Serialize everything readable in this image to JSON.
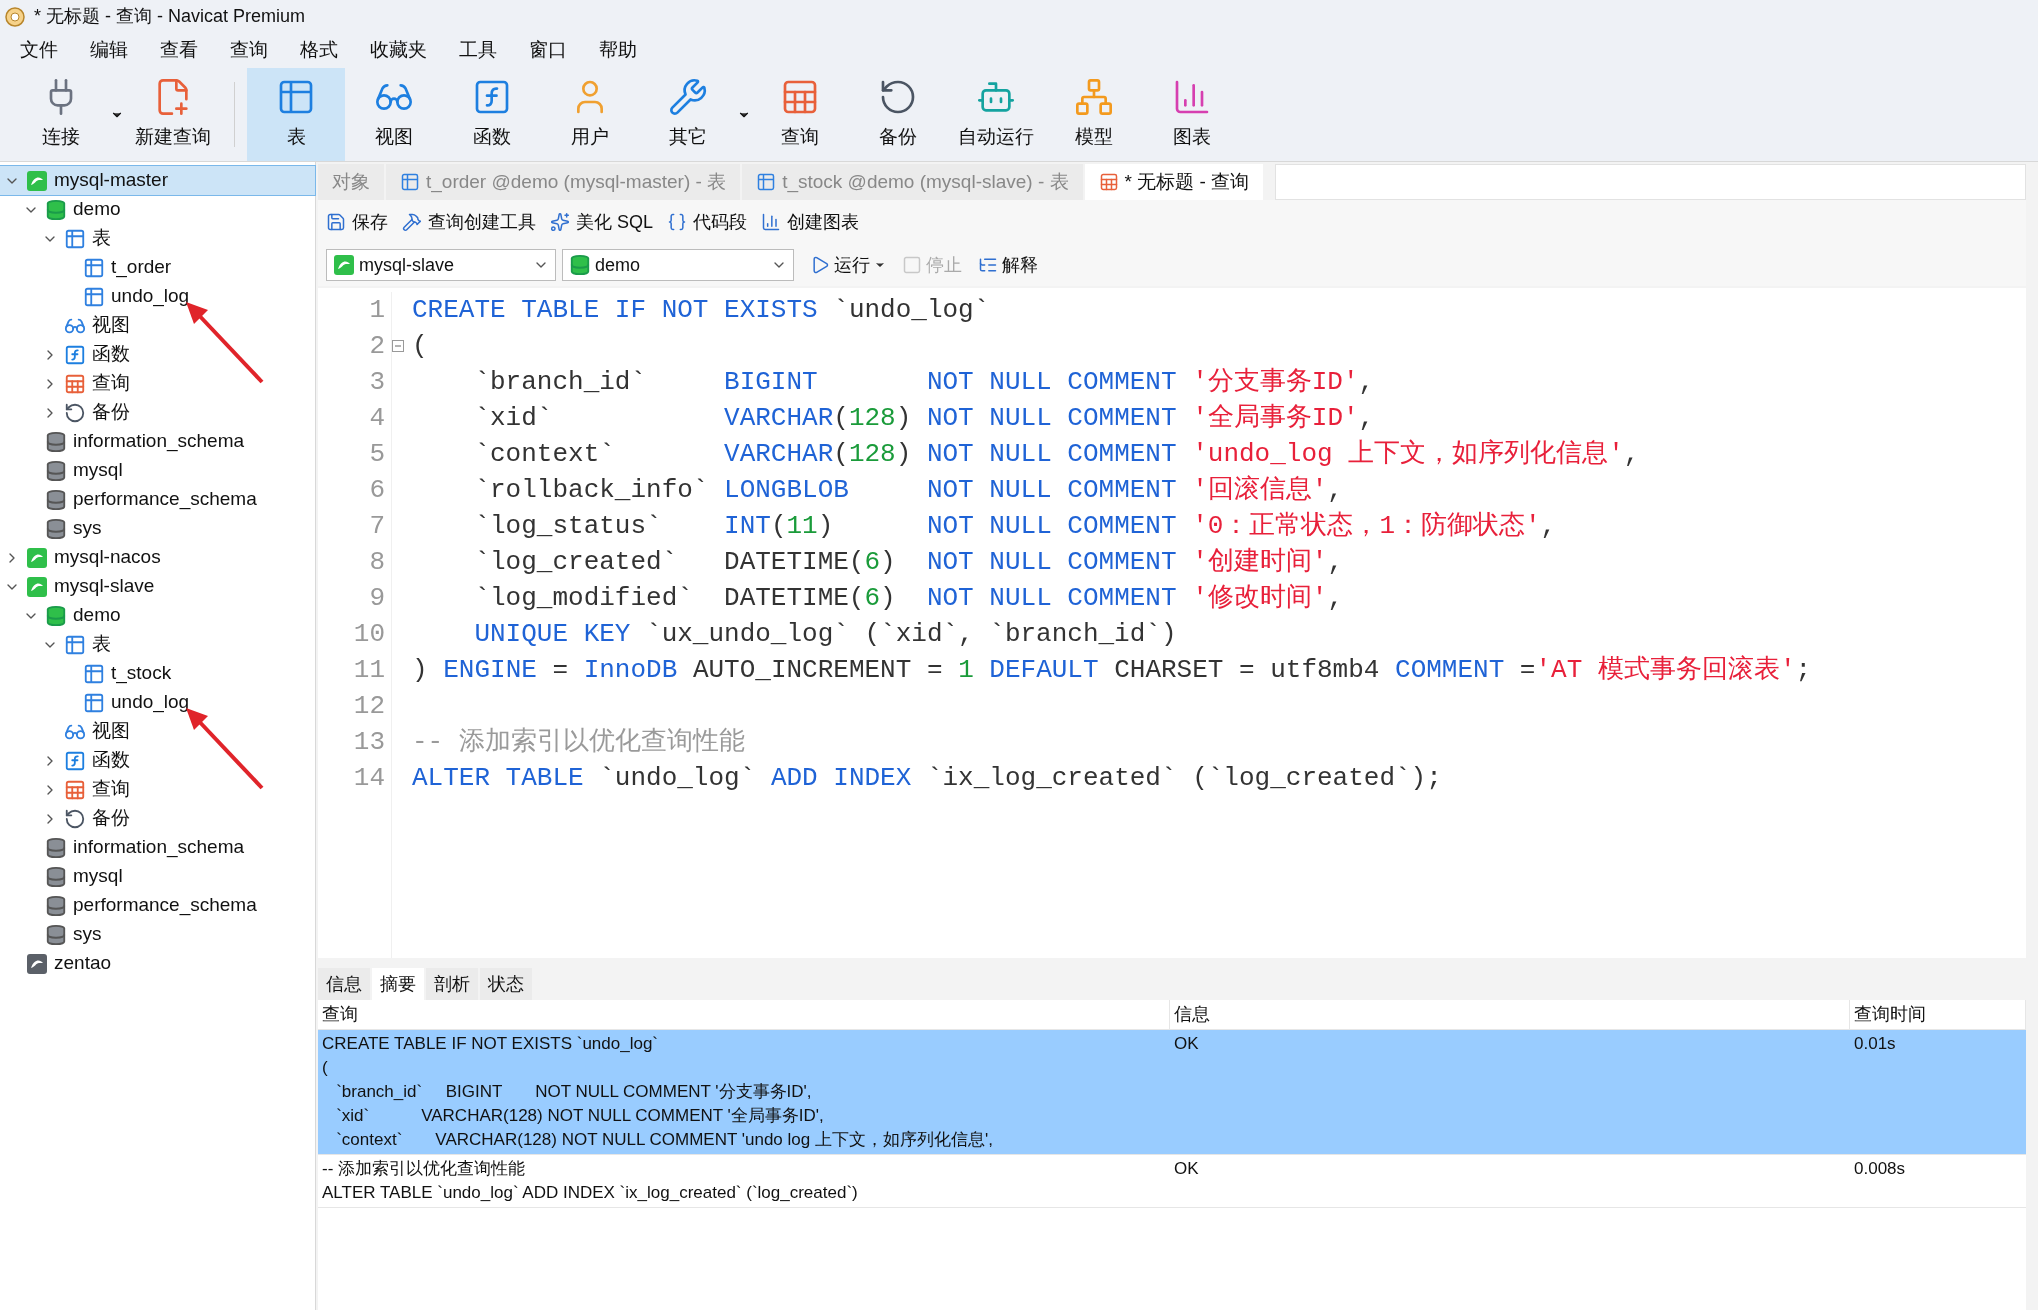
{
  "window": {
    "title": "* 无标题 - 查询 - Navicat Premium"
  },
  "menu": [
    "文件",
    "编辑",
    "查看",
    "查询",
    "格式",
    "收藏夹",
    "工具",
    "窗口",
    "帮助"
  ],
  "toolbar": [
    {
      "label": "连接",
      "kind": "plug",
      "selected": false,
      "dropdown": true
    },
    {
      "label": "新建查询",
      "kind": "new-query",
      "selected": false,
      "dropdown": false
    },
    {
      "label": "表",
      "kind": "table",
      "selected": true,
      "dropdown": false
    },
    {
      "label": "视图",
      "kind": "view",
      "selected": false,
      "dropdown": false
    },
    {
      "label": "函数",
      "kind": "function",
      "selected": false,
      "dropdown": false
    },
    {
      "label": "用户",
      "kind": "user",
      "selected": false,
      "dropdown": false
    },
    {
      "label": "其它",
      "kind": "tools",
      "selected": false,
      "dropdown": true
    },
    {
      "label": "查询",
      "kind": "query",
      "selected": false,
      "dropdown": false
    },
    {
      "label": "备份",
      "kind": "backup",
      "selected": false,
      "dropdown": false
    },
    {
      "label": "自动运行",
      "kind": "robot",
      "selected": false,
      "dropdown": false
    },
    {
      "label": "模型",
      "kind": "model",
      "selected": false,
      "dropdown": false
    },
    {
      "label": "图表",
      "kind": "chart",
      "selected": false,
      "dropdown": false
    }
  ],
  "tree": [
    {
      "label": "mysql-master",
      "kind": "connection",
      "expanded": true,
      "selected": true,
      "marked": false,
      "children": [
        {
          "label": "demo",
          "kind": "database",
          "expanded": true,
          "selected": false,
          "marked": false,
          "children": [
            {
              "label": "表",
              "kind": "tables",
              "expanded": true,
              "selected": false,
              "marked": false,
              "children": [
                {
                  "label": "t_order",
                  "kind": "table",
                  "selected": false,
                  "marked": false
                },
                {
                  "label": "undo_log",
                  "kind": "table",
                  "selected": false,
                  "marked": true
                }
              ]
            },
            {
              "label": "视图",
              "kind": "views",
              "selected": false,
              "marked": false
            },
            {
              "label": "函数",
              "kind": "functions",
              "expanded": false,
              "selected": false,
              "marked": false
            },
            {
              "label": "查询",
              "kind": "queries",
              "expanded": false,
              "selected": false,
              "marked": false
            },
            {
              "label": "备份",
              "kind": "backups",
              "expanded": false,
              "selected": false,
              "marked": false
            }
          ]
        },
        {
          "label": "information_schema",
          "kind": "database-gray",
          "selected": false,
          "marked": false
        },
        {
          "label": "mysql",
          "kind": "database-gray",
          "selected": false,
          "marked": false
        },
        {
          "label": "performance_schema",
          "kind": "database-gray",
          "selected": false,
          "marked": false
        },
        {
          "label": "sys",
          "kind": "database-gray",
          "selected": false,
          "marked": false
        }
      ]
    },
    {
      "label": "mysql-nacos",
      "kind": "connection",
      "expanded": false,
      "selected": false,
      "marked": false
    },
    {
      "label": "mysql-slave",
      "kind": "connection",
      "expanded": true,
      "selected": false,
      "marked": false,
      "children": [
        {
          "label": "demo",
          "kind": "database",
          "expanded": true,
          "selected": false,
          "marked": false,
          "children": [
            {
              "label": "表",
              "kind": "tables",
              "expanded": true,
              "selected": false,
              "marked": false,
              "children": [
                {
                  "label": "t_stock",
                  "kind": "table",
                  "selected": false,
                  "marked": false
                },
                {
                  "label": "undo_log",
                  "kind": "table",
                  "selected": false,
                  "marked": true
                }
              ]
            },
            {
              "label": "视图",
              "kind": "views",
              "selected": false,
              "marked": false
            },
            {
              "label": "函数",
              "kind": "functions",
              "expanded": false,
              "selected": false,
              "marked": false
            },
            {
              "label": "查询",
              "kind": "queries",
              "expanded": false,
              "selected": false,
              "marked": false
            },
            {
              "label": "备份",
              "kind": "backups",
              "expanded": false,
              "selected": false,
              "marked": false
            }
          ]
        },
        {
          "label": "information_schema",
          "kind": "database-gray",
          "selected": false,
          "marked": false
        },
        {
          "label": "mysql",
          "kind": "database-gray",
          "selected": false,
          "marked": false
        },
        {
          "label": "performance_schema",
          "kind": "database-gray",
          "selected": false,
          "marked": false
        },
        {
          "label": "sys",
          "kind": "database-gray",
          "selected": false,
          "marked": false
        }
      ]
    },
    {
      "label": "zentao",
      "kind": "connection-gray",
      "selected": false,
      "marked": false
    }
  ],
  "tabs": [
    {
      "label": "对象",
      "kind": "plain",
      "selected": false
    },
    {
      "label": "t_order @demo (mysql-master) - 表",
      "kind": "table",
      "selected": false
    },
    {
      "label": "t_stock @demo (mysql-slave) - 表",
      "kind": "table",
      "selected": false
    },
    {
      "label": "* 无标题 - 查询",
      "kind": "query",
      "selected": true
    }
  ],
  "editor_toolbar": [
    {
      "label": "保存",
      "kind": "save"
    },
    {
      "label": "查询创建工具",
      "kind": "builder"
    },
    {
      "label": "美化 SQL",
      "kind": "beautify"
    },
    {
      "label": "代码段",
      "kind": "snippet"
    },
    {
      "label": "创建图表",
      "kind": "chart"
    }
  ],
  "run_bar": {
    "connection": "mysql-slave",
    "database": "demo",
    "actions": [
      {
        "label": "运行",
        "kind": "play",
        "disabled": false,
        "dropdown": true
      },
      {
        "label": "停止",
        "kind": "stop",
        "disabled": true,
        "dropdown": false
      },
      {
        "label": "解释",
        "kind": "explain",
        "disabled": false,
        "dropdown": false
      }
    ]
  },
  "editor": {
    "lines": [
      {
        "number": "1",
        "fold_marker": false,
        "tokens": [
          {
            "kind": "kw",
            "text": "CREATE TABLE IF NOT EXISTS"
          },
          {
            "kind": "plain",
            "text": " `undo_log`"
          }
        ]
      },
      {
        "number": "2",
        "fold_marker": true,
        "tokens": [
          {
            "kind": "plain",
            "text": "("
          }
        ]
      },
      {
        "number": "3",
        "fold_marker": false,
        "tokens": [
          {
            "kind": "plain",
            "text": "    `branch_id`     "
          },
          {
            "kind": "kw",
            "text": "BIGINT       NOT NULL COMMENT "
          },
          {
            "kind": "str",
            "text": "'分支事务ID'"
          },
          {
            "kind": "plain",
            "text": ","
          }
        ]
      },
      {
        "number": "4",
        "fold_marker": false,
        "tokens": [
          {
            "kind": "plain",
            "text": "    `xid`           "
          },
          {
            "kind": "kw",
            "text": "VARCHAR"
          },
          {
            "kind": "plain",
            "text": "("
          },
          {
            "kind": "num",
            "text": "128"
          },
          {
            "kind": "plain",
            "text": ")"
          },
          {
            "kind": "kw",
            "text": " NOT NULL COMMENT "
          },
          {
            "kind": "str",
            "text": "'全局事务ID'"
          },
          {
            "kind": "plain",
            "text": ","
          }
        ]
      },
      {
        "number": "5",
        "fold_marker": false,
        "tokens": [
          {
            "kind": "plain",
            "text": "    `context`       "
          },
          {
            "kind": "kw",
            "text": "VARCHAR"
          },
          {
            "kind": "plain",
            "text": "("
          },
          {
            "kind": "num",
            "text": "128"
          },
          {
            "kind": "plain",
            "text": ")"
          },
          {
            "kind": "kw",
            "text": " NOT NULL COMMENT "
          },
          {
            "kind": "str",
            "text": "'undo_log 上下文，如序列化信息'"
          },
          {
            "kind": "plain",
            "text": ","
          }
        ]
      },
      {
        "number": "6",
        "fold_marker": false,
        "tokens": [
          {
            "kind": "plain",
            "text": "    `rollback_info` "
          },
          {
            "kind": "kw",
            "text": "LONGBLOB     NOT NULL COMMENT "
          },
          {
            "kind": "str",
            "text": "'回滚信息'"
          },
          {
            "kind": "plain",
            "text": ","
          }
        ]
      },
      {
        "number": "7",
        "fold_marker": false,
        "tokens": [
          {
            "kind": "plain",
            "text": "    `log_status`    "
          },
          {
            "kind": "kw",
            "text": "INT"
          },
          {
            "kind": "plain",
            "text": "("
          },
          {
            "kind": "num",
            "text": "11"
          },
          {
            "kind": "plain",
            "text": ")"
          },
          {
            "kind": "kw",
            "text": "      NOT NULL COMMENT "
          },
          {
            "kind": "str",
            "text": "'0：正常状态，1：防御状态'"
          },
          {
            "kind": "plain",
            "text": ","
          }
        ]
      },
      {
        "number": "8",
        "fold_marker": false,
        "tokens": [
          {
            "kind": "plain",
            "text": "    `log_created`   DATETIME("
          },
          {
            "kind": "num",
            "text": "6"
          },
          {
            "kind": "plain",
            "text": ")"
          },
          {
            "kind": "kw",
            "text": "  NOT NULL COMMENT "
          },
          {
            "kind": "str",
            "text": "'创建时间'"
          },
          {
            "kind": "plain",
            "text": ","
          }
        ]
      },
      {
        "number": "9",
        "fold_marker": false,
        "tokens": [
          {
            "kind": "plain",
            "text": "    `log_modified`  DATETIME("
          },
          {
            "kind": "num",
            "text": "6"
          },
          {
            "kind": "plain",
            "text": ")"
          },
          {
            "kind": "kw",
            "text": "  NOT NULL COMMENT "
          },
          {
            "kind": "str",
            "text": "'修改时间'"
          },
          {
            "kind": "plain",
            "text": ","
          }
        ]
      },
      {
        "number": "10",
        "fold_marker": false,
        "tokens": [
          {
            "kind": "kw",
            "text": "    UNIQUE KEY"
          },
          {
            "kind": "plain",
            "text": " `ux_undo_log` (`xid`, `branch_id`)"
          }
        ]
      },
      {
        "number": "11",
        "fold_marker": false,
        "tokens": [
          {
            "kind": "plain",
            "text": ") "
          },
          {
            "kind": "kw",
            "text": "ENGINE"
          },
          {
            "kind": "plain",
            "text": " = "
          },
          {
            "kind": "kw",
            "text": "InnoDB"
          },
          {
            "kind": "plain",
            "text": " AUTO_INCREMENT = "
          },
          {
            "kind": "num",
            "text": "1"
          },
          {
            "kind": "kw",
            "text": " DEFAULT"
          },
          {
            "kind": "plain",
            "text": " CHARSET = utf8mb4 "
          },
          {
            "kind": "kw",
            "text": "COMMENT"
          },
          {
            "kind": "plain",
            "text": " ="
          },
          {
            "kind": "str",
            "text": "'AT 模式事务回滚表'"
          },
          {
            "kind": "plain",
            "text": ";"
          }
        ]
      },
      {
        "number": "12",
        "fold_marker": false
      },
      {
        "number": "13",
        "fold_marker": false,
        "tokens": [
          {
            "kind": "comment",
            "text": "-- 添加索引以优化查询性能"
          }
        ]
      },
      {
        "number": "14",
        "fold_marker": false,
        "tokens": [
          {
            "kind": "kw",
            "text": "ALTER TABLE"
          },
          {
            "kind": "plain",
            "text": " `undo_log` "
          },
          {
            "kind": "kw",
            "text": "ADD INDEX"
          },
          {
            "kind": "plain",
            "text": " `ix_log_created` (`log_created`);"
          }
        ]
      }
    ]
  },
  "results": {
    "tabs": [
      {
        "label": "信息",
        "selected": false
      },
      {
        "label": "摘要",
        "selected": true
      },
      {
        "label": "剖析",
        "selected": false
      },
      {
        "label": "状态",
        "selected": false
      }
    ],
    "columns": [
      "查询",
      "信息",
      "查询时间"
    ],
    "rows": [
      {
        "query": "CREATE TABLE IF NOT EXISTS `undo_log`\n(\n   `branch_id`     BIGINT       NOT NULL COMMENT '分支事务ID',\n   `xid`           VARCHAR(128) NOT NULL COMMENT '全局事务ID',\n   `context`       VARCHAR(128) NOT NULL COMMENT 'undo log 上下文，如序列化信息',",
        "info": "OK",
        "time": "0.01s",
        "selected": true
      },
      {
        "query": "-- 添加索引以优化查询性能\nALTER TABLE `undo_log` ADD INDEX `ix_log_created` (`log_created`)",
        "info": "OK",
        "time": "0.008s",
        "selected": false
      }
    ]
  }
}
